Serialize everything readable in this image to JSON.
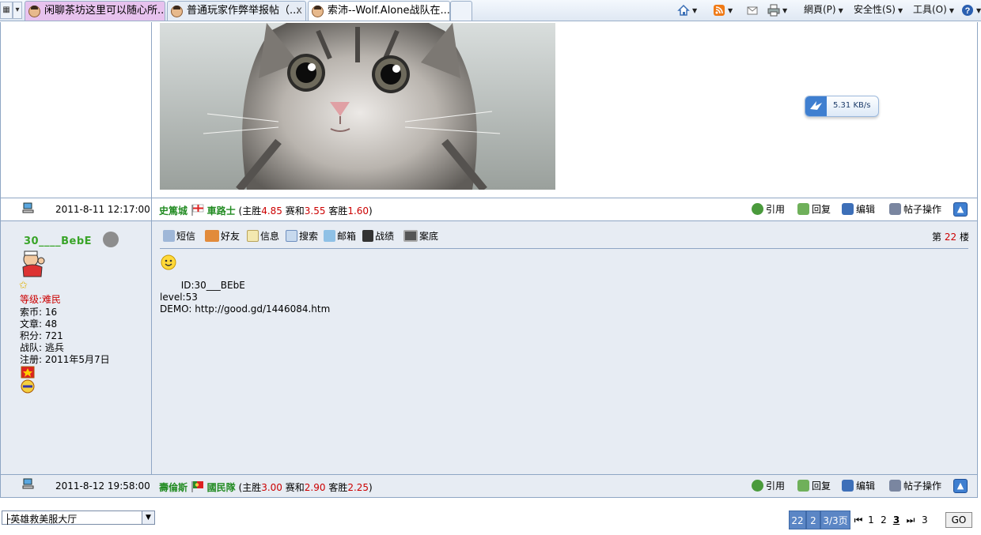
{
  "browser": {
    "tabs": [
      {
        "title": "闲聊茶坊这里可以随心所...",
        "color": "#e7c2ee"
      },
      {
        "title": "普通玩家作弊举报帖（...",
        "color": "#e6ecf5",
        "close": "x"
      },
      {
        "title": "索沛--Wolf.Alone战队在...",
        "color": "#ffffff"
      }
    ],
    "commands": {
      "home": "home-icon",
      "feeds": "rss-icon",
      "mail": "mail-icon",
      "print": "print-icon",
      "page": "網頁(P)",
      "safety": "安全性(S)",
      "tools": "工具(O)",
      "help": "help-icon"
    }
  },
  "speed_widget": {
    "value": "5.31 KB/s"
  },
  "post1_footer": {
    "time": "2011-8-11 12:17:00",
    "city": "史篤城",
    "faction": "車路士",
    "open": "(主胜",
    "home_odds": "4.85",
    "draw_label": "赛和",
    "draw_odds": "3.55",
    "away_label": "客胜",
    "away_odds": "1.60",
    "close": ")"
  },
  "post2": {
    "username": "30____BebE",
    "level_label": "等级:",
    "level_value": "难民",
    "coins_label": "索币:",
    "coins": "16",
    "articles_label": "文章:",
    "articles": "48",
    "points_label": "积分:",
    "points": "721",
    "team_label": "战队:",
    "team": "逃兵",
    "reg_label": "注册:",
    "reg_date": "2011年5月7日",
    "toolbar": [
      "短信",
      "好友",
      "信息",
      "搜索",
      "邮箱",
      "战绩",
      "案底"
    ],
    "floor_prefix": "第",
    "floor": "22",
    "floor_suffix": "楼",
    "lines": [
      "       ID:30___BEbE",
      "level:53",
      "DEMO: http://good.gd/1446084.htm"
    ]
  },
  "post2_footer": {
    "time": "2011-8-12 19:58:00",
    "city": "壽倫斯",
    "faction": "國民隊",
    "open": "(主胜",
    "home_odds": "3.00",
    "draw_label": "赛和",
    "draw_odds": "2.90",
    "away_label": "客胜",
    "away_odds": "2.25",
    "close": ")"
  },
  "actions": {
    "quote": "引用",
    "reply": "回复",
    "edit": "编辑",
    "manage": "帖子操作"
  },
  "forum_select": {
    "value": "├英雄救美服大厅"
  },
  "pager": {
    "total": "22",
    "pages": "2",
    "current": "3/3页",
    "first": "⏮",
    "p1": "1",
    "p2": "2",
    "p3": "3",
    "last": "⏭",
    "jump": "3",
    "go": "GO"
  },
  "colors": {
    "accent_red": "#cc0000",
    "green": "#228b22",
    "border": "#8fa6c4",
    "pager_bg": "#5b86c5"
  }
}
